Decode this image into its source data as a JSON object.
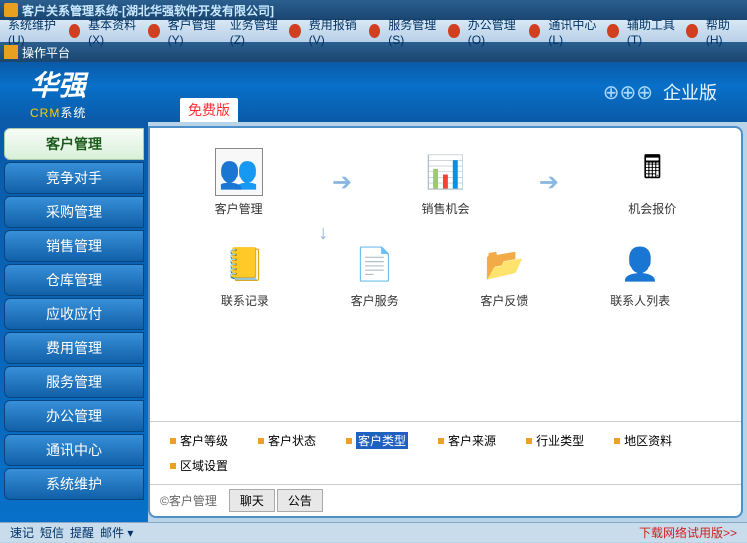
{
  "titlebar": {
    "text": "客户关系管理系统-[湖北华强软件开发有限公司]"
  },
  "menubar": {
    "items": [
      {
        "label": "系统维护(U)"
      },
      {
        "label": "基本资料(X)"
      },
      {
        "label": "客户管理(Y)"
      },
      {
        "label": "业务管理(Z)"
      },
      {
        "label": "费用报销(V)"
      },
      {
        "label": "服务管理(S)"
      },
      {
        "label": "办公管理(O)"
      },
      {
        "label": "通讯中心(L)"
      },
      {
        "label": "辅助工具(T)"
      },
      {
        "label": "帮助(H)"
      }
    ]
  },
  "subtitle": {
    "text": "操作平台"
  },
  "header": {
    "logo": "华强",
    "logo_sub_yellow": "CRM",
    "logo_sub_white": "系统",
    "free": "免费版",
    "edition": "企业版"
  },
  "sidebar": {
    "items": [
      {
        "label": "客户管理",
        "active": true
      },
      {
        "label": "竞争对手"
      },
      {
        "label": "采购管理"
      },
      {
        "label": "销售管理"
      },
      {
        "label": "仓库管理"
      },
      {
        "label": "应收应付"
      },
      {
        "label": "费用管理"
      },
      {
        "label": "服务管理"
      },
      {
        "label": "办公管理"
      },
      {
        "label": "通讯中心"
      },
      {
        "label": "系统维护"
      }
    ]
  },
  "workflow": {
    "row1": [
      {
        "label": "客户管理",
        "icon": "👥",
        "boxed": true
      },
      {
        "label": "销售机会",
        "icon": "📊"
      },
      {
        "label": "机会报价",
        "icon": "🖩"
      }
    ],
    "row2": [
      {
        "label": "联系记录",
        "icon": "📒"
      },
      {
        "label": "客户服务",
        "icon": "📄"
      },
      {
        "label": "客户反馈",
        "icon": "📂"
      },
      {
        "label": "联系人列表",
        "icon": "👤"
      }
    ]
  },
  "links": {
    "items": [
      {
        "label": "客户等级"
      },
      {
        "label": "客户状态"
      },
      {
        "label": "客户类型",
        "active": true
      },
      {
        "label": "客户来源"
      },
      {
        "label": "行业类型"
      },
      {
        "label": "地区资料"
      },
      {
        "label": "区域设置"
      }
    ]
  },
  "tabs": {
    "copyright": "©客户管理",
    "items": [
      {
        "label": "聊天"
      },
      {
        "label": "公告"
      }
    ]
  },
  "statusbar": {
    "left": [
      {
        "label": "速记"
      },
      {
        "label": "短信"
      },
      {
        "label": "提醒"
      },
      {
        "label": "邮件 ▾"
      }
    ],
    "download": "下载网络试用版>>"
  }
}
